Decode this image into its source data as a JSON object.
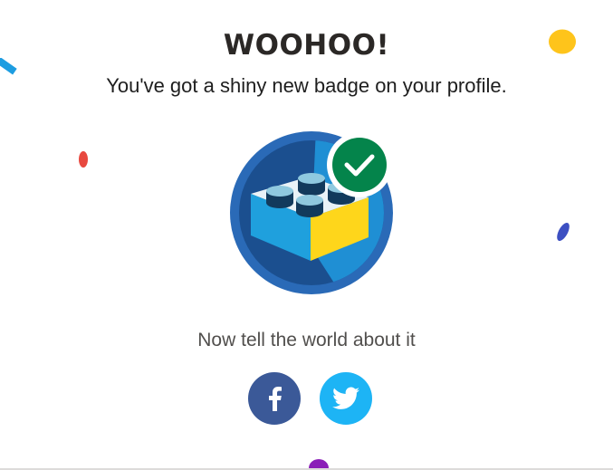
{
  "modal": {
    "headline": "WOOHOO!",
    "subline": "You've got a shiny new badge on your profile.",
    "share_prompt": "Now tell the world about it"
  },
  "badge": {
    "icon": "lego-brick-badge-icon",
    "status_icon": "checkmark-icon",
    "colors": {
      "ring": "#2a6ab7",
      "inner_dark": "#1b4f8f",
      "inner_light": "#1f8fd4",
      "brick_blue": "#1fa0dd",
      "brick_yellow": "#fed61b",
      "check_green": "#04844b"
    }
  },
  "share": {
    "facebook": {
      "icon": "facebook-icon",
      "color": "#3b5998"
    },
    "twitter": {
      "icon": "twitter-icon",
      "color": "#1db4f5"
    }
  },
  "confetti_colors": [
    "#fec41b",
    "#1d9de1",
    "#e8483f",
    "#3c4fc2",
    "#8b1fb8"
  ]
}
